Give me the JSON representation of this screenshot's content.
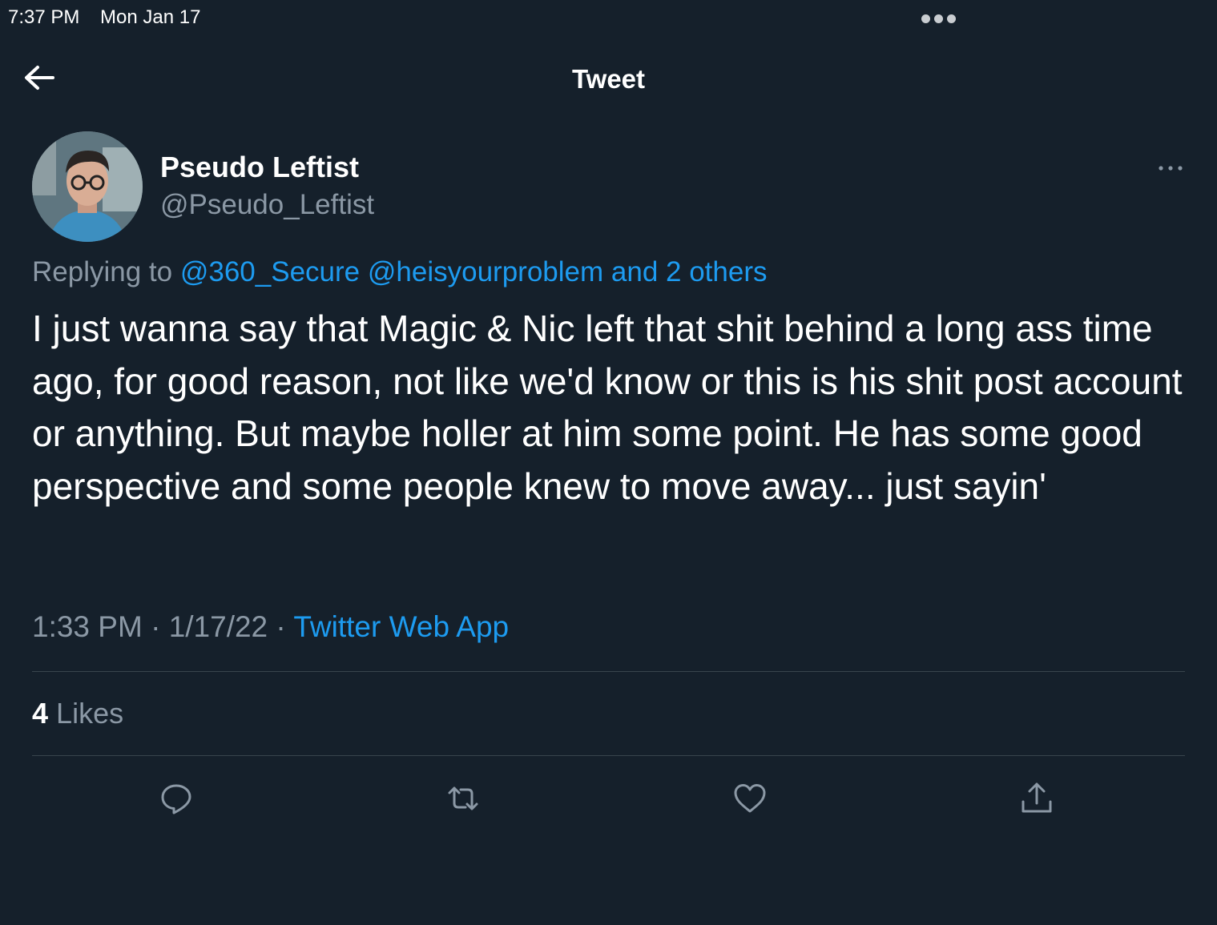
{
  "status_bar": {
    "time": "7:37 PM",
    "date": "Mon Jan 17"
  },
  "header": {
    "title": "Tweet",
    "back_icon": "arrow-left-icon"
  },
  "tweet": {
    "author": {
      "name": "Pseudo Leftist",
      "handle": "@Pseudo_Leftist"
    },
    "reply_to": {
      "prefix": "Replying to",
      "mention_1": "@360_Secure",
      "mention_2": "@heisyourproblem",
      "others": "and 2 others"
    },
    "text": "I just wanna say that Magic & Nic left that shit behind a long ass time ago, for good reason, not like we'd know or this is his shit post account or anything. But maybe holler at him some point. He has some good perspective and some people knew to move away... just sayin'",
    "time": "1:33 PM",
    "separator": "·",
    "date": "1/17/22",
    "source": "Twitter Web App",
    "likes": {
      "count": "4",
      "label": "Likes"
    }
  },
  "actions": {
    "reply_icon": "reply-icon",
    "retweet_icon": "retweet-icon",
    "like_icon": "heart-icon",
    "share_icon": "share-icon"
  },
  "colors": {
    "background": "#15202b",
    "link": "#1d9bf0",
    "secondary_text": "#8b98a5",
    "divider": "#38444d",
    "icon": "#8b98a5"
  }
}
